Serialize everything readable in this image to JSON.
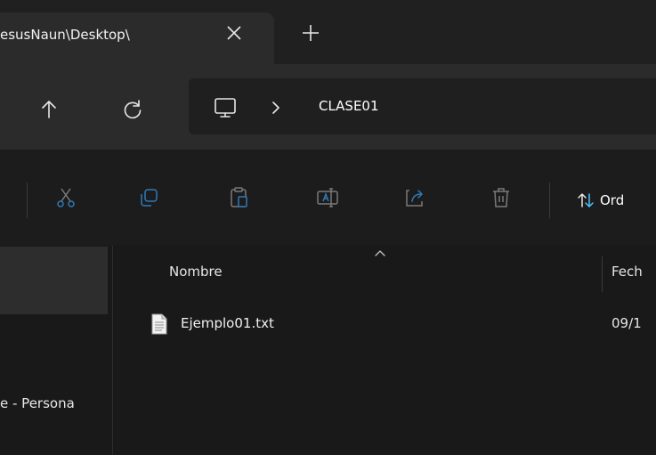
{
  "tab": {
    "title": "esusNaun\\Desktop\\",
    "close_glyph": "×",
    "new_tab_glyph": "+"
  },
  "address_bar": {
    "breadcrumb": "CLASE01",
    "location_icon": "computer-icon"
  },
  "toolbar": {
    "icons": [
      "cut-icon",
      "copy-icon",
      "paste-icon",
      "rename-icon",
      "share-icon",
      "delete-icon"
    ],
    "sort_label": "Ord"
  },
  "nav_pane": {
    "label": "e - Persona"
  },
  "file_list": {
    "columns": {
      "name": "Nombre",
      "date": "Fech"
    },
    "rows": [
      {
        "name": "Ejemplo01.txt",
        "date": "09/1"
      }
    ]
  },
  "colors": {
    "accent": "#4cc2ff",
    "background": "#191919"
  }
}
